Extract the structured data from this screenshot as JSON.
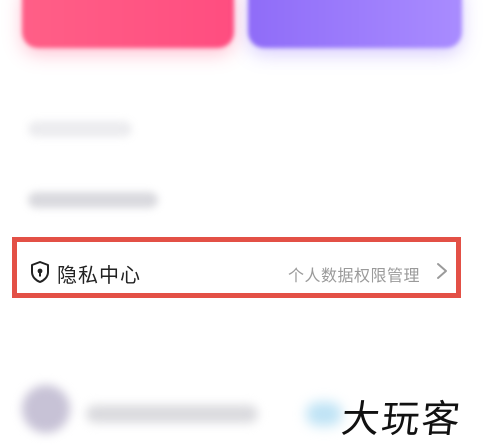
{
  "top_cards": {
    "left_color": "#ff5a85",
    "right_color": "#9b7cf9"
  },
  "privacy_row": {
    "title": "隐私中心",
    "description": "个人数据权限管理",
    "icon": "shield-lock-icon",
    "chevron": "chevron-right-icon",
    "highlight_color": "#e35046"
  },
  "watermark": {
    "text": "大玩客"
  }
}
